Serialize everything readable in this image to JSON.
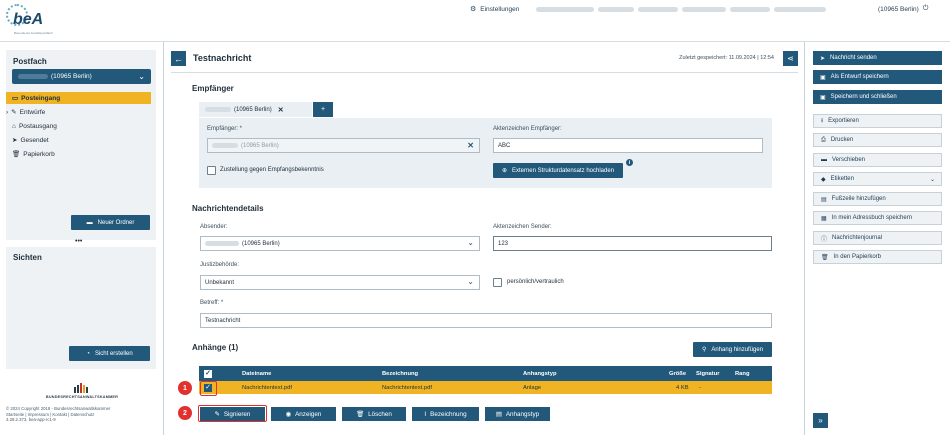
{
  "header": {
    "logo_text": "beA",
    "logo_tagline": "Besonderes Anwaltspostfach",
    "settings_label": "Einstellungen",
    "user_label": "(10965 Berlin)"
  },
  "sidebar": {
    "title": "Postfach",
    "mailbox": "(10965 Berlin)",
    "items": [
      {
        "label": "Posteingang"
      },
      {
        "label": "Entwürfe"
      },
      {
        "label": "Postausgang"
      },
      {
        "label": "Gesendet"
      },
      {
        "label": "Papierkorb"
      }
    ],
    "new_folder": "Neuer Ordner",
    "more": "•••",
    "views_title": "Sichten",
    "create_view": "Sicht erstellen",
    "bra_label": "BUNDESRECHTSANWALTSKAMMER",
    "footer_lines": [
      "© 2024 Copyright 2018 - Bundesrechtsanwaltskammer",
      "Startseite | Impressum | Kontakt | Datenschutz",
      "3.28.2.373, bea-app-rc1-9"
    ]
  },
  "message": {
    "title": "Testnachricht",
    "saved": "Zuletzt gespeichert: 11.09.2024 | 12:54",
    "recipients_title": "Empfänger",
    "recipient_chip": "(10965 Berlin)",
    "recipient_label": "Empfänger: *",
    "recipient_value": "(10965 Berlin)",
    "az_recipient_label": "Aktenzeichen Empfänger:",
    "az_recipient_value": "ABC",
    "delivery_label": "Zustellung gegen Empfangsbekenntnis",
    "upload_label": "Externen Strukturdatensatz hochladen",
    "details_title": "Nachrichtendetails",
    "sender_label": "Absender:",
    "sender_value": "(10965 Berlin)",
    "az_sender_label": "Aktenzeichen Sender:",
    "az_sender_value": "123",
    "authority_label": "Justizbehörde:",
    "authority_value": "Unbekannt",
    "confidential_label": "persönlich/vertraulich",
    "subject_label": "Betreff: *",
    "subject_value": "Testnachricht",
    "attachments_title": "Anhänge (1)",
    "add_attachment": "Anhang hinzufügen",
    "table": {
      "headers": [
        "Dateiname",
        "Bezeichnung",
        "Anhangstyp",
        "Größe",
        "Signatur",
        "Rang"
      ],
      "rows": [
        {
          "file": "Nachrichtentext.pdf",
          "desc": "Nachrichtentext.pdf",
          "type": "Anlage",
          "size": "4 KB",
          "sig": "-",
          "rank": ""
        }
      ]
    },
    "toolbar": [
      "Signieren",
      "Anzeigen",
      "Löschen",
      "Bezeichnung",
      "Anhangstyp"
    ],
    "markers": [
      "1",
      "2"
    ]
  },
  "actions": [
    "Nachricht senden",
    "Als Entwurf speichern",
    "Speichern und schließen",
    "Exportieren",
    "Drucken",
    "Verschieben",
    "Etiketten",
    "Fußzeile hinzufügen",
    "In mein Adressbuch speichern",
    "Nachrichtenjournal",
    "In den Papierkorb"
  ],
  "colors": {
    "primary": "#22597b",
    "accent": "#f0b323",
    "highlight": "#e0312f"
  }
}
